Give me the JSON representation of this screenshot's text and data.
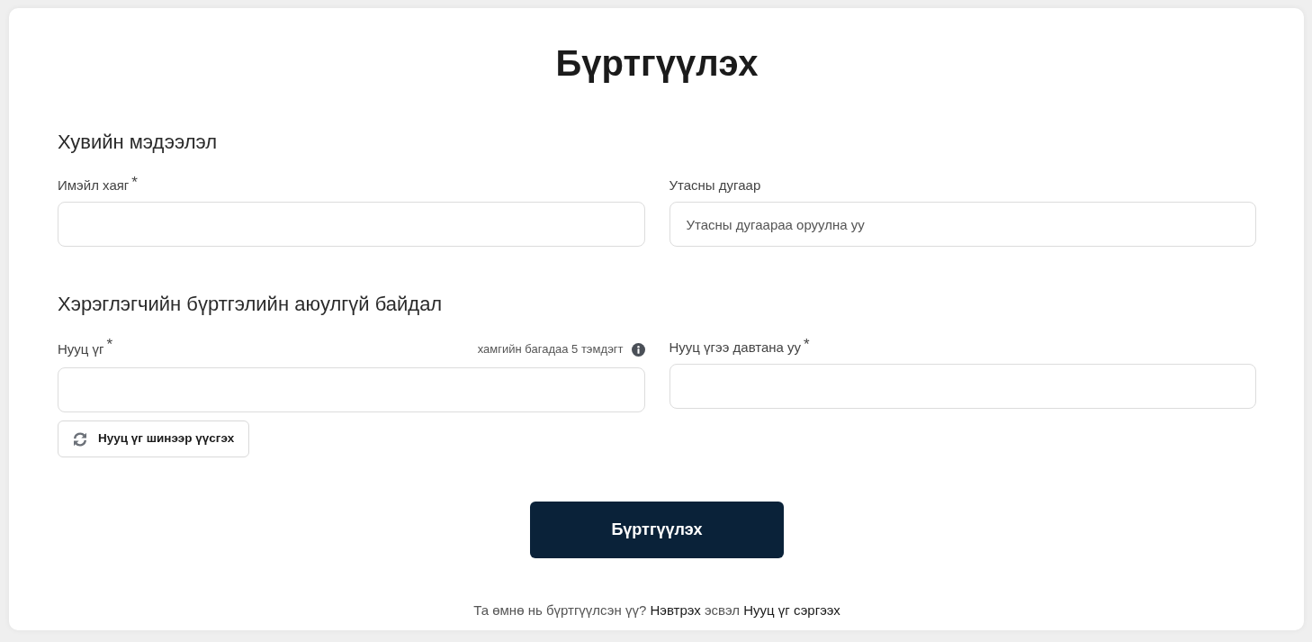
{
  "title": "Бүртгүүлэх",
  "sections": [
    {
      "heading": "Хувийн мэдээлэл",
      "fields": [
        {
          "label": "Имэйл хаяг",
          "required_mark": "*"
        },
        {
          "label": "Утасны дугаар",
          "placeholder": "Утасны дугаараа оруулна уу"
        }
      ]
    },
    {
      "heading": "Хэрэглэгчийн бүртгэлийн аюулгүй байдал",
      "fields": [
        {
          "label": "Нууц үг",
          "required_mark": "*",
          "hint": "хамгийн багадаа 5 тэмдэгт",
          "action": "Нууц үг шинээр үүсгэх"
        },
        {
          "label": "Нууц үгээ давтана уу",
          "required_mark": "*"
        }
      ]
    }
  ],
  "submit": "Бүртгүүлэх",
  "footer": {
    "question": "Та өмнө нь бүртгүүлсэн үү?",
    "login_link": "Нэвтрэх",
    "connector": "эсвэл",
    "reset_link": "Нууц үг сэргээх"
  }
}
